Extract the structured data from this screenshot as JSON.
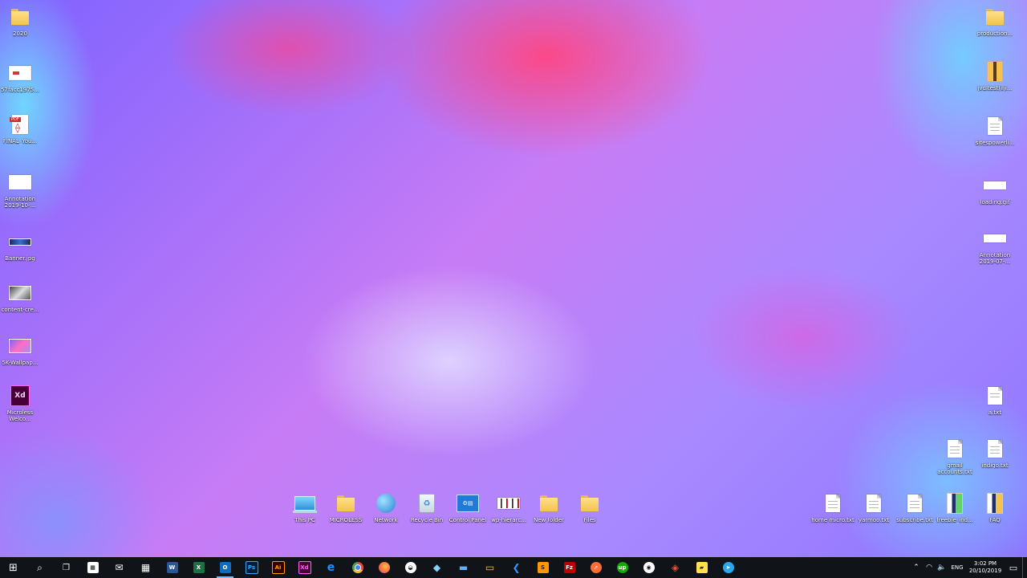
{
  "desktop": {
    "left_icons": [
      {
        "label": "2020",
        "icon": "folder-icon"
      },
      {
        "label": "57facc1975...",
        "icon": "image-thumbnail-icon"
      },
      {
        "label": "FINAL_You...",
        "icon": "pdf-icon"
      },
      {
        "label": "Annotation 2019-10-...",
        "icon": "image-thumbnail-icon"
      },
      {
        "label": "Banner.jpg",
        "icon": "image-thumbnail-icon"
      },
      {
        "label": "content-cre...",
        "icon": "image-thumbnail-icon"
      },
      {
        "label": "5K-Wallpap...",
        "icon": "image-thumbnail-icon"
      },
      {
        "label": "Microless Welco...",
        "icon": "adobe-xd-icon"
      }
    ],
    "right_icons": [
      {
        "label": "production...",
        "icon": "folder-icon"
      },
      {
        "label": "jvdltest(ilji...",
        "icon": "archive-icon"
      },
      {
        "label": "sitespowerli...",
        "icon": "text-file-icon"
      },
      {
        "label": "loading.gif",
        "icon": "image-thumbnail-icon"
      },
      {
        "label": "Annotation 2019-07-...",
        "icon": "image-thumbnail-icon"
      },
      {
        "label": "a.txt",
        "icon": "text-file-icon"
      },
      {
        "label": "gmail accounts.txt",
        "icon": "text-file-icon"
      },
      {
        "label": "indigo.txt",
        "icon": "text-file-icon"
      },
      {
        "label": "home micro.txt",
        "icon": "text-file-icon"
      },
      {
        "label": "yarmoo.txt",
        "icon": "text-file-icon"
      },
      {
        "label": "subscribe.txt",
        "icon": "text-file-icon"
      },
      {
        "label": "freebie_ind...",
        "icon": "archive-icon"
      },
      {
        "label": "FAQ",
        "icon": "archive-icon"
      }
    ],
    "bottom_icons": [
      {
        "label": "This PC",
        "icon": "computer-icon"
      },
      {
        "label": "MICROLESS",
        "icon": "user-folder-icon"
      },
      {
        "label": "Network",
        "icon": "network-icon"
      },
      {
        "label": "Recycle Bin",
        "icon": "recycle-bin-icon"
      },
      {
        "label": "Control Panel",
        "icon": "control-panel-icon"
      },
      {
        "label": "wp-hierarc...",
        "icon": "image-thumbnail-icon"
      },
      {
        "label": "New folder",
        "icon": "folder-icon"
      },
      {
        "label": "Files",
        "icon": "folder-icon"
      }
    ]
  },
  "taskbar": {
    "apps": [
      {
        "name": "start-button",
        "glyph": "⊞",
        "color": "#ffffff"
      },
      {
        "name": "search-button",
        "glyph": "⌕",
        "color": "#ffffff"
      },
      {
        "name": "task-view-button",
        "glyph": "❐",
        "color": "#ffffff"
      },
      {
        "name": "store-app",
        "glyph": "🛍",
        "color": "#ffffff"
      },
      {
        "name": "mail-app",
        "glyph": "✉",
        "color": "#ffffff"
      },
      {
        "name": "calculator-app",
        "glyph": "▦",
        "color": "#ffffff"
      },
      {
        "name": "word-app",
        "glyph": "W",
        "color": "#2b5797"
      },
      {
        "name": "excel-app",
        "glyph": "X",
        "color": "#1d7044"
      },
      {
        "name": "outlook-app",
        "glyph": "O",
        "color": "#0f6cbd"
      },
      {
        "name": "photoshop-app",
        "glyph": "Ps",
        "color": "#31a8ff"
      },
      {
        "name": "illustrator-app",
        "glyph": "Ai",
        "color": "#ff9a00"
      },
      {
        "name": "xd-app",
        "glyph": "Xd",
        "color": "#ff61f6"
      },
      {
        "name": "edge-app",
        "glyph": "e",
        "color": "#1e90ff"
      },
      {
        "name": "chrome-app",
        "glyph": "●",
        "color": "#e8453c"
      },
      {
        "name": "firefox-app",
        "glyph": "●",
        "color": "#ff7139"
      },
      {
        "name": "photos-app",
        "glyph": "◒",
        "color": "#ffffff"
      },
      {
        "name": "paint-app",
        "glyph": "◆",
        "color": "#7fd3ff"
      },
      {
        "name": "remote-desktop-app",
        "glyph": "▬",
        "color": "#5fb0ff"
      },
      {
        "name": "file-explorer-app",
        "glyph": "▭",
        "color": "#f4c34d"
      },
      {
        "name": "vscode-app",
        "glyph": "❮",
        "color": "#2f9bff"
      },
      {
        "name": "sublime-app",
        "glyph": "S",
        "color": "#ff9800"
      },
      {
        "name": "filezilla-app",
        "glyph": "Fz",
        "color": "#bf0000"
      },
      {
        "name": "postman-app",
        "glyph": "➚",
        "color": "#ff6c37"
      },
      {
        "name": "upwork-app",
        "glyph": "up",
        "color": "#14a800"
      },
      {
        "name": "obs-app",
        "glyph": "◉",
        "color": "#ffffff"
      },
      {
        "name": "git-app",
        "glyph": "◈",
        "color": "#f05033"
      },
      {
        "name": "sticky-notes-app",
        "glyph": "▰",
        "color": "#ffe14d"
      },
      {
        "name": "telegram-app",
        "glyph": "➤",
        "color": "#29a9eb"
      }
    ],
    "tray": {
      "language": "ENG",
      "time": "3:02 PM",
      "date": "20/10/2019"
    }
  }
}
